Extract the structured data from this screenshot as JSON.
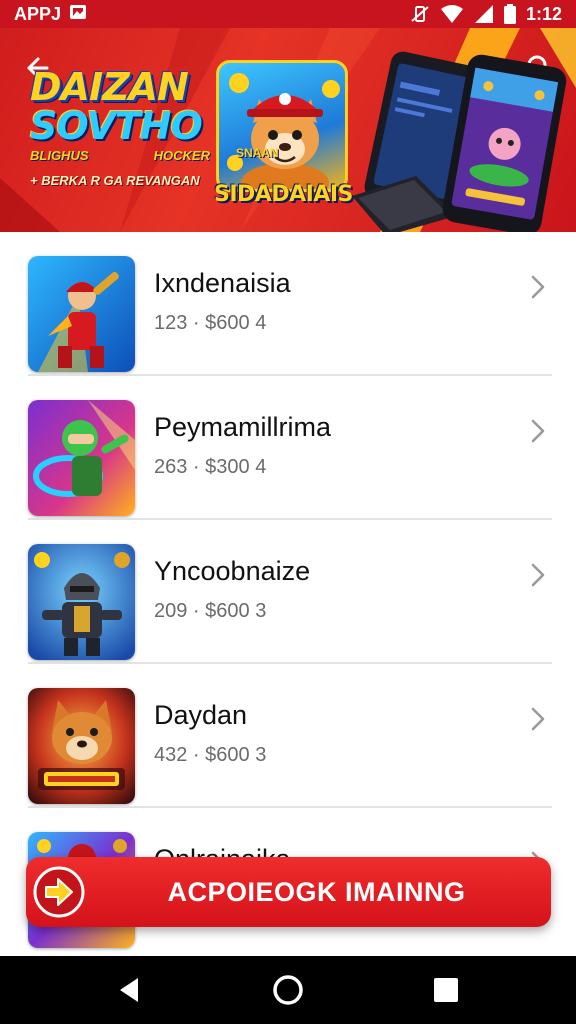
{
  "status_bar": {
    "app_label": "APPJ",
    "time": "1:12"
  },
  "banner": {
    "logo_line1": "DAIZAN",
    "logo_line2": "SOVTHO",
    "logo_sub_left": "BLIGHUS",
    "logo_sub_right": "HOCKER",
    "tagline": "+ BERKA R GA REVANGAN",
    "mascot_small_title": "SNAAN",
    "mascot_title": "SIDADAIAIS"
  },
  "games": [
    {
      "name": "Ixndenaisia",
      "meta": "123 · $600 4",
      "art": "hero-icon"
    },
    {
      "name": "Peymamillrima",
      "meta": "263 · $300 4",
      "art": "robot-icon"
    },
    {
      "name": "Yncoobnaize",
      "meta": "209 · $600 3",
      "art": "knight-icon"
    },
    {
      "name": "Daydan",
      "meta": "432 · $600 3",
      "art": "fox-icon"
    },
    {
      "name": "Onlrainaika",
      "meta": "",
      "art": "warrior-icon"
    }
  ],
  "cta": {
    "label": "ACPOIEOGK IMAINNG"
  },
  "colors": {
    "brand_red": "#d4121a",
    "status_red": "#c8141e",
    "accent_yellow": "#ffd21f"
  }
}
